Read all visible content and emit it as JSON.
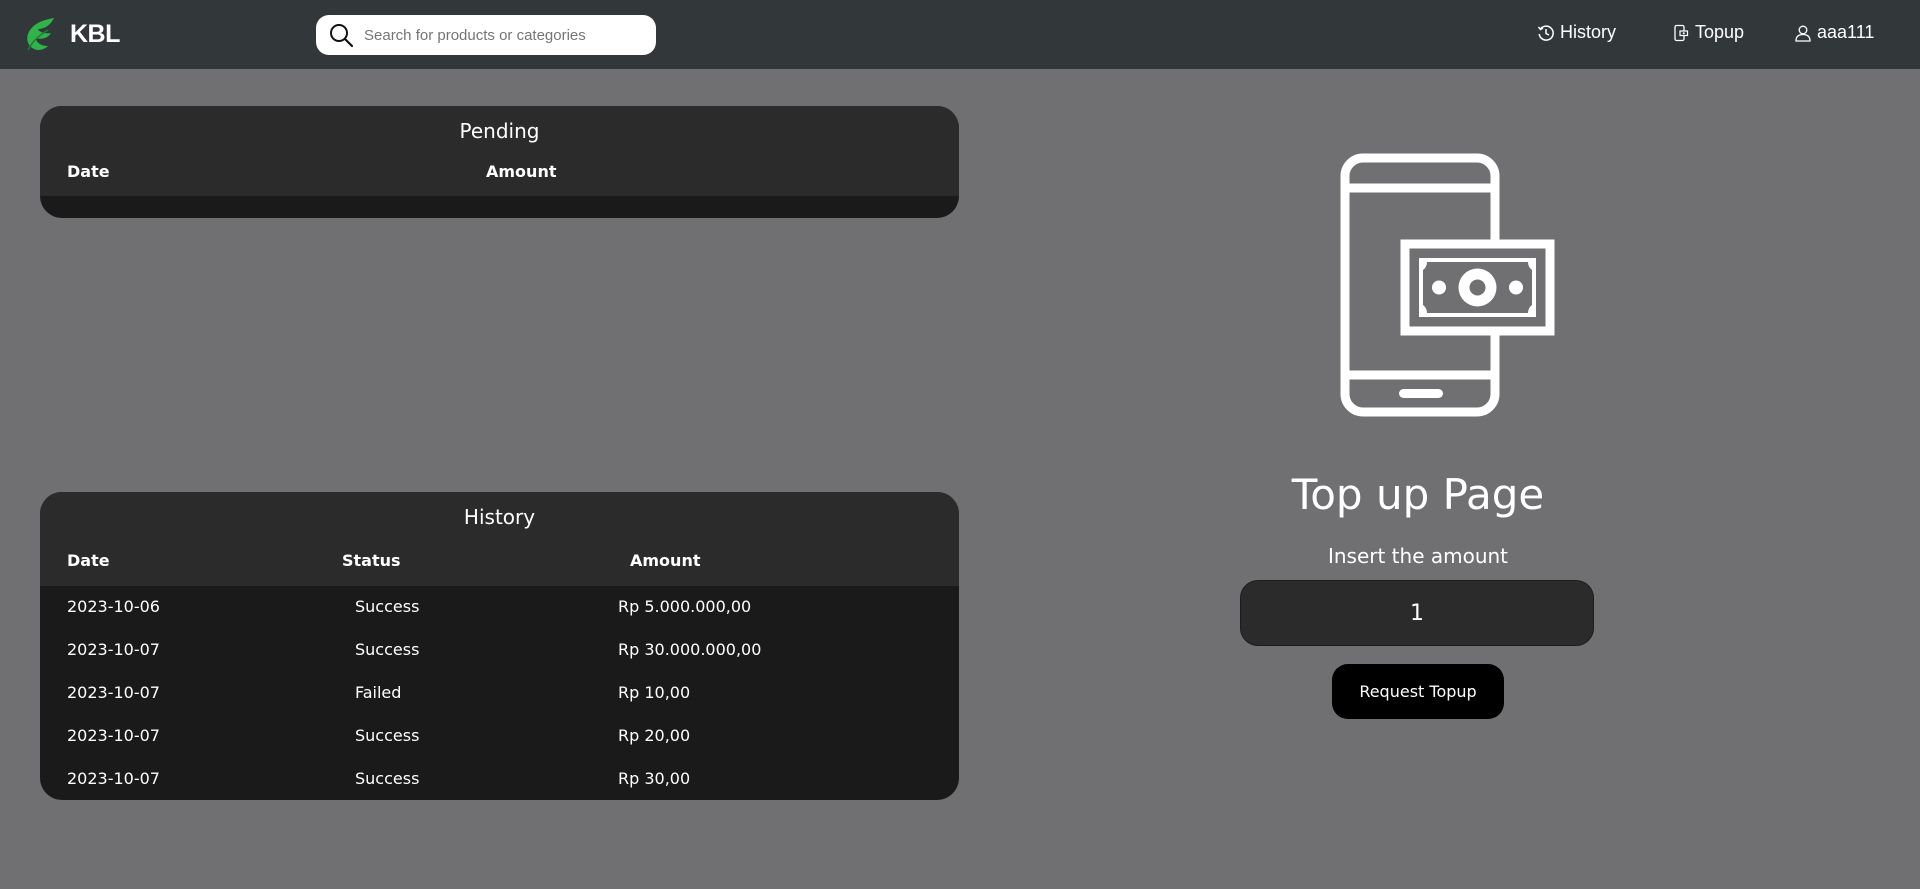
{
  "header": {
    "brand": "KBL",
    "search_placeholder": "Search for products or categories",
    "nav": {
      "history": "History",
      "topup": "Topup",
      "user": "aaa111"
    }
  },
  "pending": {
    "title": "Pending",
    "columns": [
      "Date",
      "Amount"
    ]
  },
  "history": {
    "title": "History",
    "columns": [
      "Date",
      "Status",
      "Amount"
    ],
    "rows": [
      {
        "date": "2023-10-06",
        "status": "Success",
        "amount": "Rp 5.000.000,00"
      },
      {
        "date": "2023-10-07",
        "status": "Success",
        "amount": "Rp 30.000.000,00"
      },
      {
        "date": "2023-10-07",
        "status": "Failed",
        "amount": "Rp 10,00"
      },
      {
        "date": "2023-10-07",
        "status": "Success",
        "amount": "Rp 20,00"
      },
      {
        "date": "2023-10-07",
        "status": "Success",
        "amount": "Rp 30,00"
      }
    ]
  },
  "topup": {
    "icon": "phone-money-icon",
    "title": "Top up Page",
    "label": "Insert the amount",
    "amount_value": "1",
    "button": "Request Topup"
  },
  "colors": {
    "background": "#707072",
    "navbar": "#32383a",
    "card_header": "#2b2b2b",
    "card_body": "#1a1a1a",
    "logo_green": "#2fb34a"
  }
}
